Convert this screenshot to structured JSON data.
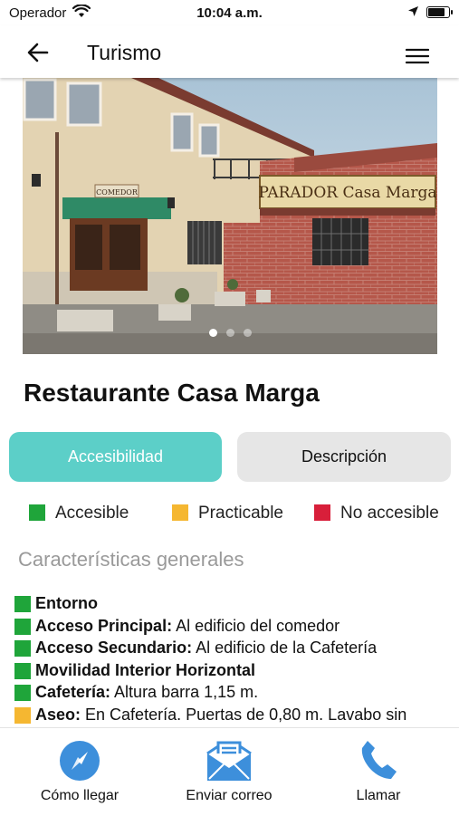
{
  "status_bar": {
    "carrier": "Operador",
    "time": "10:04 a.m.",
    "battery_level": 0.9
  },
  "nav": {
    "title": "Turismo",
    "back_icon": "arrow-left-icon",
    "menu_icon": "hamburger-menu-icon"
  },
  "gallery": {
    "image_sign_parador": "PARADOR Casa Marga",
    "image_sign_comedor": "COMEDOR",
    "slide_count": 3,
    "active_slide": 1
  },
  "place": {
    "name": "Restaurante Casa Marga"
  },
  "tabs": [
    {
      "label": "Accesibilidad",
      "active": true
    },
    {
      "label": "Descripción",
      "active": false
    }
  ],
  "legend": [
    {
      "label": "Accesible",
      "color": "#1fa53a"
    },
    {
      "label": "Practicable",
      "color": "#f5b731"
    },
    {
      "label": "No accesible",
      "color": "#d81f3a"
    }
  ],
  "section_heading": "Características generales",
  "features": [
    {
      "title": "Entorno",
      "detail": "",
      "color": "#1fa53a"
    },
    {
      "title": "Acceso Principal:",
      "detail": "Al edificio del comedor",
      "color": "#1fa53a"
    },
    {
      "title": "Acceso Secundario:",
      "detail": "Al edificio de la Cafetería",
      "color": "#1fa53a"
    },
    {
      "title": "Movilidad Interior Horizontal",
      "detail": "",
      "color": "#1fa53a"
    },
    {
      "title": "Cafetería:",
      "detail": "Altura barra 1,15 m.",
      "color": "#1fa53a"
    },
    {
      "title": "Aseo:",
      "detail": "En Cafetería. Puertas de 0,80 m. Lavabo sin",
      "color": "#f5b731"
    }
  ],
  "actions": [
    {
      "label": "Cómo llegar",
      "icon": "compass-icon"
    },
    {
      "label": "Enviar correo",
      "icon": "mail-icon"
    },
    {
      "label": "Llamar",
      "icon": "phone-icon"
    }
  ],
  "accent_color": "#5ccfc8",
  "icon_color": "#3d8fdb"
}
